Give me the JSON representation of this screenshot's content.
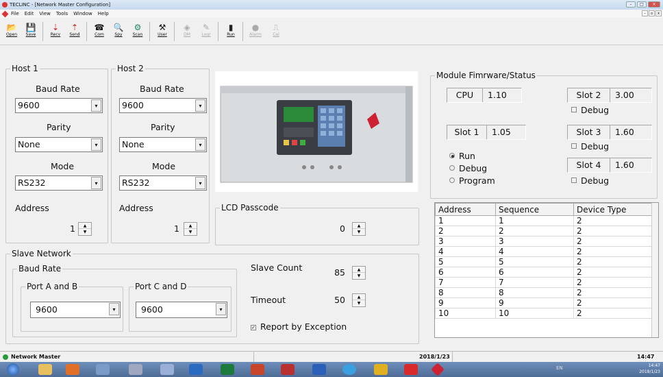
{
  "window": {
    "title": "TECLINC - [Network Master Configuration]",
    "min": "–",
    "max": "□",
    "close": "✕"
  },
  "menu": [
    "File",
    "Edit",
    "View",
    "Tools",
    "Window",
    "Help"
  ],
  "toolbar": [
    {
      "label": "Open",
      "icon": "📂",
      "enabled": true
    },
    {
      "label": "Save",
      "icon": "💾",
      "enabled": true
    },
    {
      "label": "Recv",
      "icon": "⇣",
      "enabled": true
    },
    {
      "label": "Send",
      "icon": "⇡",
      "enabled": true
    },
    {
      "label": "Com",
      "icon": "☎",
      "enabled": true
    },
    {
      "label": "Spy",
      "icon": "🔍",
      "enabled": true
    },
    {
      "label": "Scan",
      "icon": "⚙",
      "enabled": true
    },
    {
      "label": "User",
      "icon": "⚒",
      "enabled": true
    },
    {
      "label": "DM",
      "icon": "◈",
      "enabled": false
    },
    {
      "label": "Logr",
      "icon": "✎",
      "enabled": false
    },
    {
      "label": "Run",
      "icon": "▮",
      "enabled": true
    },
    {
      "label": "Alarm",
      "icon": "●",
      "enabled": false
    },
    {
      "label": "Cal",
      "icon": "⎍",
      "enabled": false
    }
  ],
  "host1": {
    "title": "Host 1",
    "baud_label": "Baud Rate",
    "baud": "9600",
    "parity_label": "Parity",
    "parity": "None",
    "mode_label": "Mode",
    "mode": "RS232",
    "address_label": "Address",
    "address": "1"
  },
  "host2": {
    "title": "Host 2",
    "baud_label": "Baud Rate",
    "baud": "9600",
    "parity_label": "Parity",
    "parity": "None",
    "mode_label": "Mode",
    "mode": "RS232",
    "address_label": "Address",
    "address": "1"
  },
  "lcd": {
    "title": "LCD Passcode",
    "value": "0"
  },
  "slave": {
    "title": "Slave Network",
    "baud_title": "Baud Rate",
    "portab_title": "Port A and B",
    "portab": "9600",
    "portcd_title": "Port C and D",
    "portcd": "9600",
    "count_label": "Slave Count",
    "count": "85",
    "timeout_label": "Timeout",
    "timeout": "50",
    "report_label": "Report by Exception",
    "report_checked": true
  },
  "module": {
    "title": "Module Fimrware/Status",
    "cpu": {
      "name": "CPU",
      "ver": "1.10"
    },
    "slot1": {
      "name": "Slot 1",
      "ver": "1.05"
    },
    "slot2": {
      "name": "Slot 2",
      "ver": "3.00"
    },
    "slot3": {
      "name": "Slot 3",
      "ver": "1.60"
    },
    "slot4": {
      "name": "Slot 4",
      "ver": "1.60"
    },
    "debug_label": "Debug",
    "run_label": "Run",
    "debug_mode_label": "Debug",
    "program_label": "Program",
    "selected_mode": "Run"
  },
  "table": {
    "headers": [
      "Address",
      "Sequence",
      "Device Type"
    ],
    "rows": [
      [
        "1",
        "1",
        "2"
      ],
      [
        "2",
        "2",
        "2"
      ],
      [
        "3",
        "3",
        "2"
      ],
      [
        "4",
        "4",
        "2"
      ],
      [
        "5",
        "5",
        "2"
      ],
      [
        "6",
        "6",
        "2"
      ],
      [
        "7",
        "7",
        "2"
      ],
      [
        "8",
        "8",
        "2"
      ],
      [
        "9",
        "9",
        "2"
      ],
      [
        "10",
        "10",
        "2"
      ]
    ]
  },
  "status": {
    "app": "Network Master",
    "date": "2018/1/23",
    "time": "14:47"
  },
  "taskbar": {
    "lang": "EN",
    "time": "14:47",
    "date": "2018/1/23"
  },
  "colors": {
    "titlebar": "#c6d9ee",
    "taskbar": "#4e6c96",
    "close": "#d8504b"
  }
}
